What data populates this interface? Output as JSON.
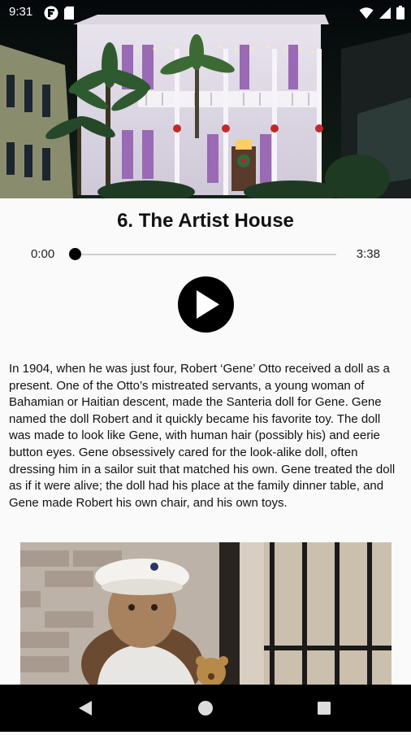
{
  "status_bar": {
    "time": "9:31",
    "left_icons": [
      "flipboard-icon",
      "sd-card-icon"
    ],
    "right_icons": [
      "wifi-icon",
      "signal-icon",
      "battery-icon"
    ]
  },
  "hero_image": {
    "subject": "artist-house-photo"
  },
  "title": "6. The Artist House",
  "player": {
    "current_time": "0:00",
    "total_time": "3:38",
    "progress": 0,
    "play_icon": "play-icon"
  },
  "description": "In 1904, when he was just four, Robert ‘Gene’ Otto received a doll as a present. One of the Otto’s mistreated servants, a young woman of Bahamian or Haitian descent, made the Santeria doll for Gene. Gene named the doll Robert and it quickly became his favorite toy. The doll was made to look like Gene, with human hair (possibly his) and eerie button eyes. Gene obsessively cared for the look-alike doll, often dressing him in a sailor suit that matched his own. Gene treated the doll as if it were alive; the doll had his place at the family dinner table, and Gene made Robert his own chair, and his own toys.",
  "content_image": {
    "subject": "robert-doll-photo"
  },
  "nav_bar": {
    "buttons": [
      "back-icon",
      "home-icon",
      "recents-icon"
    ]
  }
}
